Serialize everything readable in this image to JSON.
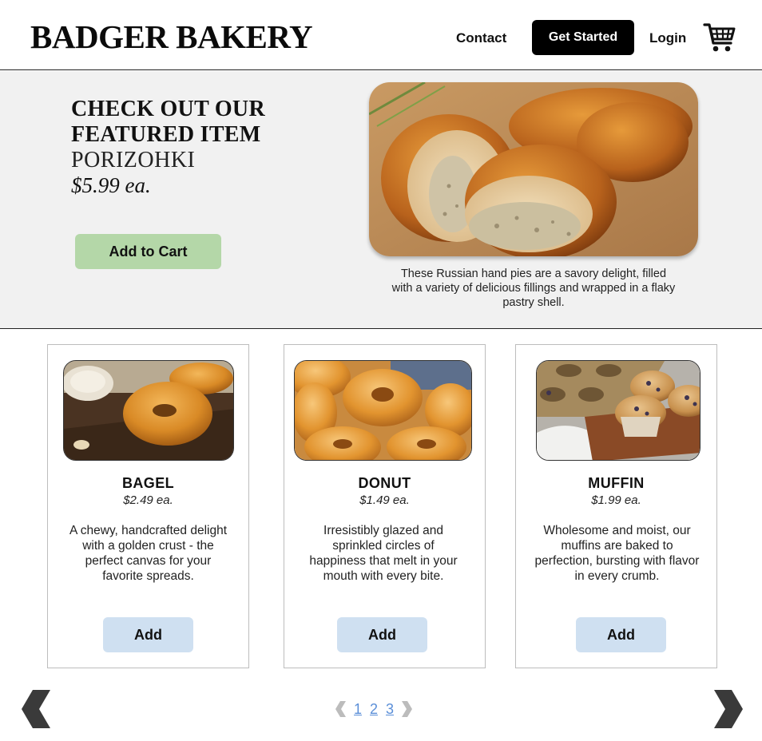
{
  "header": {
    "brand": "BADGER BAKERY",
    "nav": {
      "contact": "Contact",
      "get_started": "Get Started",
      "login": "Login"
    },
    "cart_icon": "shopping-cart-icon"
  },
  "featured": {
    "heading": "CHECK OUT OUR FEATURED ITEM",
    "item_name": "PORIZOHKI",
    "price": "$5.99 ea.",
    "add_to_cart": "Add to Cart",
    "description": "These Russian hand pies are a savory delight, filled with a variety of delicious fillings and wrapped in a flaky pastry shell."
  },
  "products": [
    {
      "name": "BAGEL",
      "price": "$2.49 ea.",
      "description": "A chewy, handcrafted delight with a golden crust - the perfect canvas for your favorite spreads.",
      "button": "Add"
    },
    {
      "name": "DONUT",
      "price": "$1.49 ea.",
      "description": "Irresistibly glazed and sprinkled circles of happiness that melt in your mouth with every bite.",
      "button": "Add"
    },
    {
      "name": "MUFFIN",
      "price": "$1.99 ea.",
      "description": "Wholesome and moist, our muffins are baked to perfection, bursting with flavor in every crumb.",
      "button": "Add"
    }
  ],
  "pagination": {
    "pages": [
      "1",
      "2",
      "3"
    ],
    "prev_icon": "chevron-left-icon",
    "next_icon": "chevron-right-icon"
  },
  "colors": {
    "add_to_cart_bg": "#b4d7a8",
    "add_button_bg": "#cfe0f1",
    "primary_button_bg": "#000000",
    "featured_bg": "#f1f1f1",
    "page_link": "#5b8fd8"
  }
}
